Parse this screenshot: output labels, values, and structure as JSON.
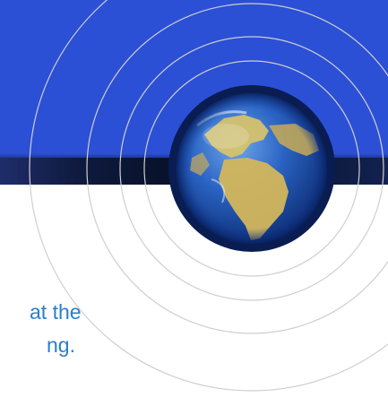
{
  "slide": {
    "text_lines": [
      "at the",
      "ng."
    ]
  },
  "colors": {
    "banner": "#2b50d6",
    "band": "#071129",
    "text": "#2a7fc9",
    "rings": "#c8c8c8",
    "ocean": "#1c4fa8",
    "land": "#d9c36a"
  },
  "graphics": {
    "globe_icon": "earth-globe-icon",
    "rings_icon": "concentric-rings"
  }
}
